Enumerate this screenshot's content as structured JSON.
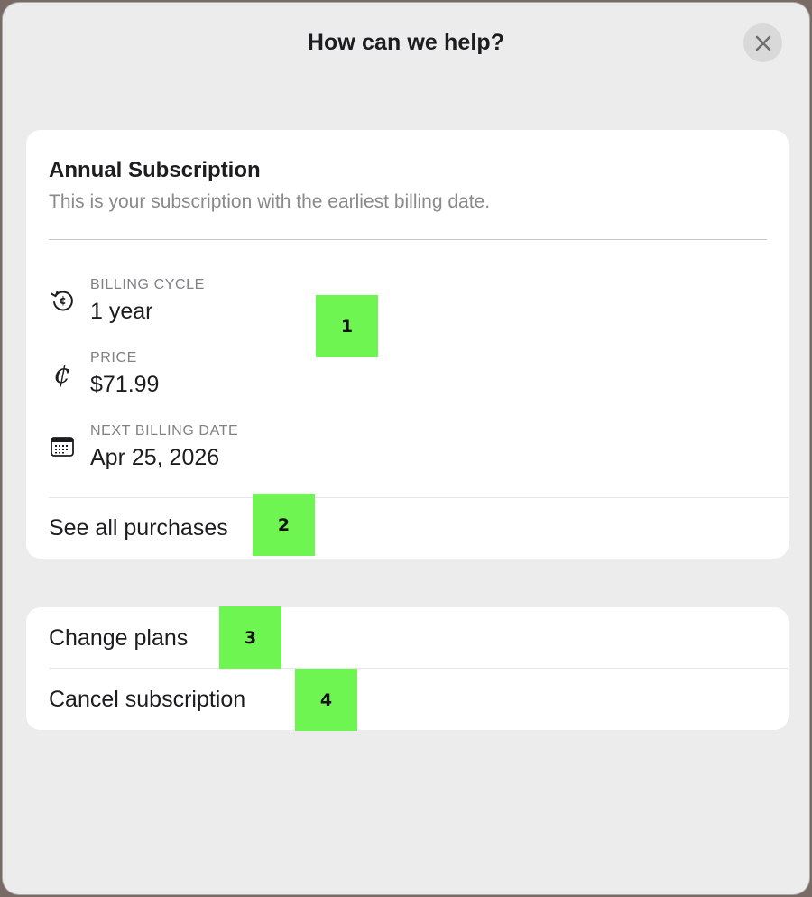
{
  "header": {
    "title": "How can we help?"
  },
  "subscription": {
    "title": "Annual Subscription",
    "description": "This is your subscription with the earliest billing date.",
    "rows": [
      {
        "label": "BILLING CYCLE",
        "value": "1 year",
        "icon": "renew-cents-icon"
      },
      {
        "label": "PRICE",
        "value": "$71.99",
        "icon": "cent-sign-icon"
      },
      {
        "label": "NEXT BILLING DATE",
        "value": "Apr 25, 2026",
        "icon": "calendar-icon"
      }
    ],
    "see_all_label": "See all purchases"
  },
  "actions": {
    "change_plans_label": "Change plans",
    "cancel_label": "Cancel subscription"
  },
  "markers": [
    "1",
    "2",
    "3",
    "4"
  ],
  "colors": {
    "background": "#ececec",
    "card": "#ffffff",
    "marker": "#6ef552",
    "text_primary": "#1d1d1f",
    "text_secondary": "#8a8a8e"
  }
}
